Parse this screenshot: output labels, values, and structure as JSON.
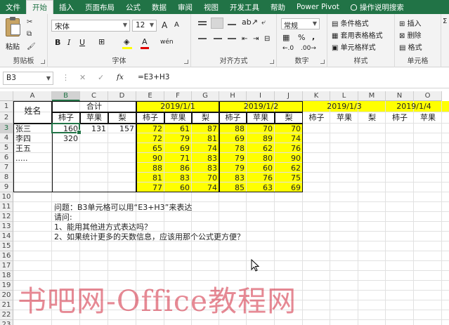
{
  "ribbon_tabs": [
    "文件",
    "开始",
    "插入",
    "页面布局",
    "公式",
    "数据",
    "审阅",
    "视图",
    "开发工具",
    "帮助",
    "Power Pivot"
  ],
  "active_tab": "开始",
  "tell_me": "操作说明搜索",
  "groups": {
    "clipboard": {
      "label": "剪贴板",
      "paste": "粘贴"
    },
    "font": {
      "label": "字体",
      "name": "宋体",
      "size": "12",
      "bold": "B",
      "italic": "I",
      "underline": "U",
      "grow": "A",
      "shrink": "A",
      "wen": "wén"
    },
    "alignment": {
      "label": "对齐方式"
    },
    "number": {
      "label": "数字",
      "format": "常规",
      "percent": "%",
      "comma": ","
    },
    "styles": {
      "label": "样式",
      "conditional": "条件格式",
      "table": "套用表格格式",
      "cell_styles": "单元格样式"
    },
    "cells": {
      "label": "单元格",
      "insert": "插入",
      "delete": "删除",
      "format": "格式"
    }
  },
  "name_box": "B3",
  "formula": "=E3+H3",
  "fx": "fx",
  "columns": [
    "A",
    "B",
    "C",
    "D",
    "E",
    "F",
    "G",
    "H",
    "I",
    "J",
    "K",
    "L",
    "M",
    "N",
    "O"
  ],
  "selected_column": "B",
  "rows": [
    "1",
    "2",
    "3",
    "4",
    "5",
    "6",
    "7",
    "8",
    "9",
    "10",
    "11",
    "12",
    "13",
    "14",
    "15",
    "16",
    "17",
    "18",
    "19",
    "20",
    "21",
    "22",
    "23"
  ],
  "selected_row": "3",
  "header": {
    "name": "姓名",
    "total": "合计",
    "dates": [
      "2019/1/1",
      "2019/1/2",
      "2019/1/3",
      "2019/1/4"
    ],
    "sub": [
      "柿子",
      "苹果",
      "梨"
    ]
  },
  "names": [
    "张三",
    "李四",
    "王五",
    "....."
  ],
  "totals": [
    [
      "160",
      "131",
      "157"
    ],
    [
      "320",
      "",
      ""
    ]
  ],
  "day_values": [
    [
      "72",
      "61",
      "87",
      "88",
      "70",
      "70"
    ],
    [
      "72",
      "79",
      "81",
      "69",
      "89",
      "74"
    ],
    [
      "65",
      "69",
      "74",
      "78",
      "62",
      "76"
    ],
    [
      "90",
      "71",
      "83",
      "79",
      "80",
      "90"
    ],
    [
      "88",
      "86",
      "83",
      "79",
      "60",
      "62"
    ],
    [
      "81",
      "83",
      "70",
      "83",
      "76",
      "75"
    ],
    [
      "77",
      "60",
      "74",
      "85",
      "63",
      "69"
    ]
  ],
  "notes": [
    "问题：B3单元格可以用“E3+H3”来表达",
    "请问:",
    "1、能用其他进方式表达吗？",
    "2、如果统计更多的天数信息，应该用那个公式更方便？"
  ],
  "watermark": "书吧网-Office教程网",
  "colors": {
    "accent": "#217346",
    "highlight": "#ffff00",
    "watermark": "#d2283c"
  }
}
